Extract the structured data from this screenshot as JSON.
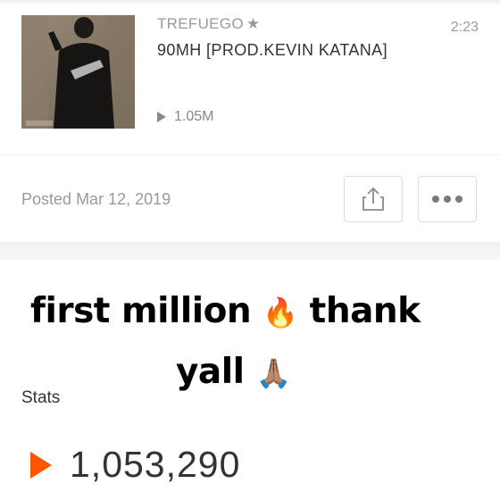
{
  "track": {
    "artist": "TREFUEGO",
    "title": "90MH [PROD.KEVIN KATANA]",
    "duration": "2:23",
    "plays": "1.05M"
  },
  "post": {
    "posted_label": "Posted",
    "posted_date": "Mar 12, 2019"
  },
  "overlay_caption": {
    "line1_text": "first million",
    "line1_emoji": "🔥",
    "line1_text2": "thank",
    "line2_text": "yall",
    "line2_emoji": "🙏🏽"
  },
  "stats": {
    "label": "Stats",
    "total_plays": "1,053,290"
  },
  "colors": {
    "accent": "#ff5500",
    "text_primary": "#333333",
    "text_secondary": "#9a9a9a"
  },
  "icons": [
    "star-icon",
    "play-icon",
    "share-icon",
    "more-icon"
  ]
}
